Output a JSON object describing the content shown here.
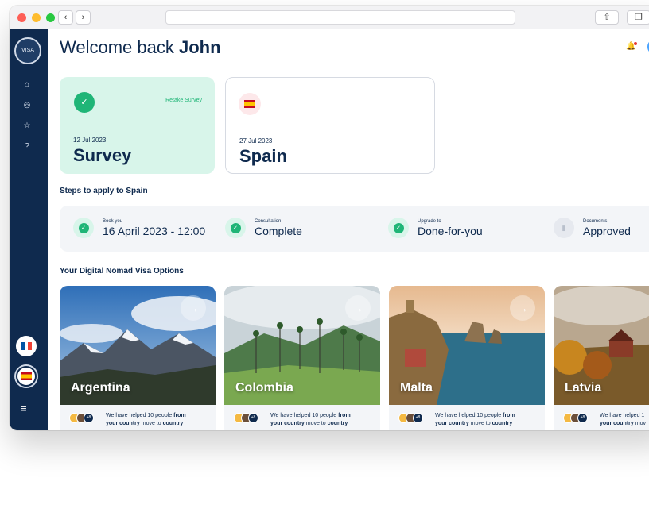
{
  "browser": {
    "back": "‹",
    "forward": "›",
    "share_icon": "share-icon",
    "tabs_icon": "tabs-icon"
  },
  "sidebar": {
    "logo_text": "VISA",
    "items": [
      {
        "icon": "home-icon",
        "glyph": "⌂"
      },
      {
        "icon": "compass-icon",
        "glyph": "◎"
      },
      {
        "icon": "star-icon",
        "glyph": "☆"
      },
      {
        "icon": "help-icon",
        "glyph": "?"
      }
    ],
    "flags": [
      "france",
      "spain"
    ],
    "menu_glyph": "≡"
  },
  "header": {
    "welcome_prefix": "Welcome back",
    "user_name": "John"
  },
  "cards": [
    {
      "date": "12 Jul 2023",
      "title": "Survey",
      "action": "Retake Survey"
    },
    {
      "date": "27 Jul 2023",
      "title": "Spain"
    }
  ],
  "steps_title": "Steps to apply to Spain",
  "steps": [
    {
      "label": "Book you",
      "value": "16 April 2023 - 12:00",
      "status": "complete"
    },
    {
      "label": "Consultation",
      "value": "Complete",
      "status": "complete"
    },
    {
      "label": "Upgrade to",
      "value": "Done-for-you",
      "status": "complete"
    },
    {
      "label": "Documents",
      "value": "Approved",
      "status": "pending"
    }
  ],
  "options_title": "Your Digital Nomad Visa Options",
  "destinations": [
    {
      "name": "Argentina",
      "helped_a": "We have helped 10 people ",
      "helped_b": "from",
      "helped_c": "your country",
      "helped_d": " move to ",
      "helped_e": "country",
      "plus": "+8"
    },
    {
      "name": "Colombia",
      "helped_a": "We have helped 10 people ",
      "helped_b": "from",
      "helped_c": "your country",
      "helped_d": " move to ",
      "helped_e": "country",
      "plus": "+8"
    },
    {
      "name": "Malta",
      "helped_a": "We have helped 10 people ",
      "helped_b": "from",
      "helped_c": "your country",
      "helped_d": " move to ",
      "helped_e": "country",
      "plus": "+8"
    },
    {
      "name": "Latvia",
      "helped_a": "We have helped 1",
      "helped_b": "",
      "helped_c": "your country",
      "helped_d": " mov",
      "helped_e": "",
      "plus": "+8"
    }
  ],
  "colors": {
    "navy": "#0f2a4e",
    "green": "#1fb577",
    "mint": "#d8f5ea"
  }
}
